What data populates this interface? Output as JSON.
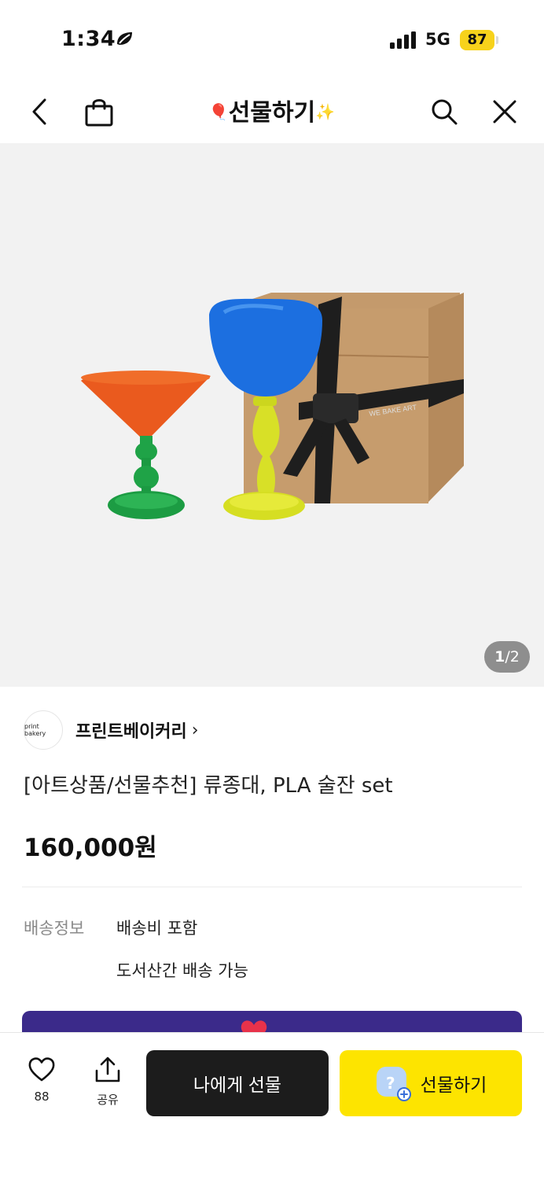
{
  "status_bar": {
    "time": "1:34",
    "network": "5G",
    "battery": "87"
  },
  "header": {
    "title": "선물하기",
    "title_left_emoji": "🎈",
    "title_right_emoji": "✨"
  },
  "product": {
    "image_page_current": "1",
    "image_page_total": "/2",
    "seller_logo_text": "print bakery",
    "seller_name": "프린트베이커리",
    "seller_chevron": "›",
    "title": "[아트상품/선물추천] 류종대, PLA 술잔 set",
    "price": "160,000원",
    "image_box_text": "WE BAKE ART"
  },
  "shipping": {
    "label": "배송정보",
    "line1": "배송비 포함",
    "line2": "도서산간 배송 가능"
  },
  "bottom_bar": {
    "like_count": "88",
    "share_label": "공유",
    "self_gift_label": "나에게 선물",
    "gift_label": "선물하기"
  },
  "colors": {
    "gift_button": "#fde400",
    "self_gift_button": "#1c1c1c",
    "battery_badge": "#f7d21b",
    "promo_banner": "#3b2a8a"
  }
}
